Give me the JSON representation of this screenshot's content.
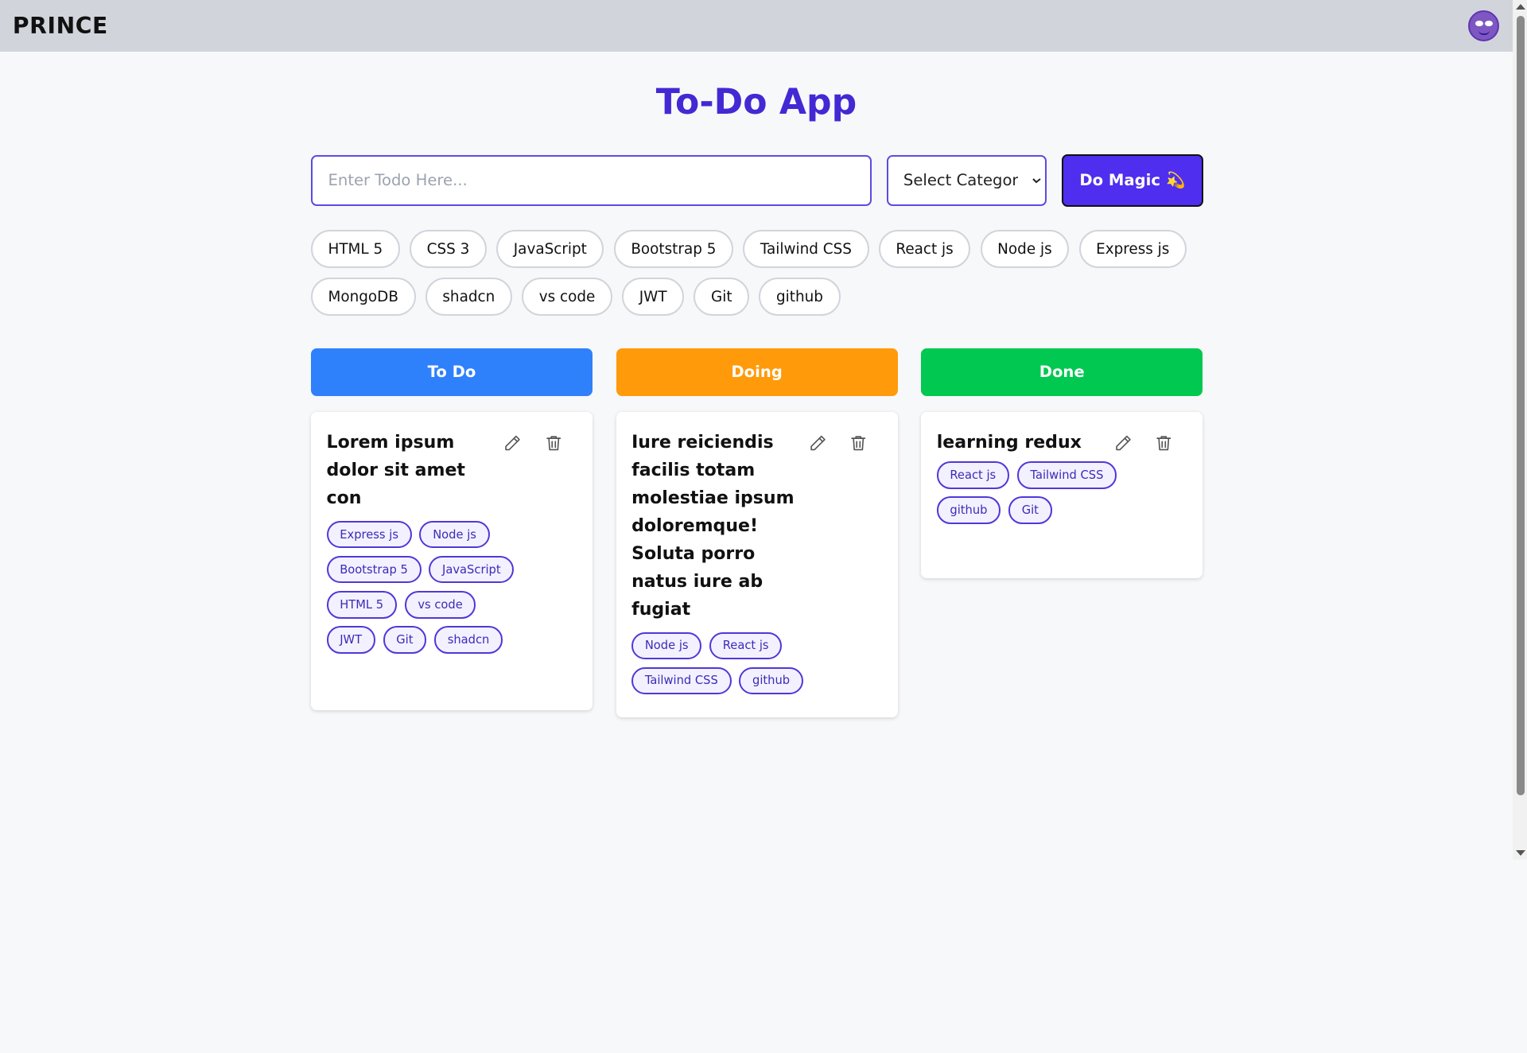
{
  "navbar": {
    "brand": "PRINCE"
  },
  "header": {
    "title": "To-Do App"
  },
  "form": {
    "input_placeholder": "Enter Todo Here...",
    "select_value": "Select Categor",
    "submit_label": "Do Magic",
    "submit_icon": "💫"
  },
  "categories": [
    "HTML 5",
    "CSS 3",
    "JavaScript",
    "Bootstrap 5",
    "Tailwind CSS",
    "React js",
    "Node js",
    "Express js",
    "MongoDB",
    "shadcn",
    "vs code",
    "JWT",
    "Git",
    "github"
  ],
  "columns": {
    "todo": {
      "label": "To Do",
      "color": "#2f80fb"
    },
    "doing": {
      "label": "Doing",
      "color": "#ff9a0a"
    },
    "done": {
      "label": "Done",
      "color": "#00c851"
    }
  },
  "cards": {
    "todo": {
      "title": "Lorem ipsum dolor sit amet con",
      "tags": [
        "Express js",
        "Node js",
        "Bootstrap 5",
        "JavaScript",
        "HTML 5",
        "vs code",
        "JWT",
        "Git",
        "shadcn"
      ]
    },
    "doing": {
      "title": "Iure reiciendis facilis totam molestiae ipsum doloremque! Soluta porro natus iure ab fugiat",
      "tags": [
        "Node js",
        "React js",
        "Tailwind CSS",
        "github"
      ]
    },
    "done": {
      "title": "learning redux",
      "tags": [
        "React js",
        "Tailwind CSS",
        "github",
        "Git"
      ]
    }
  },
  "icons": {
    "edit": "pencil-icon",
    "delete": "trash-icon",
    "avatar": "avatar-face"
  }
}
